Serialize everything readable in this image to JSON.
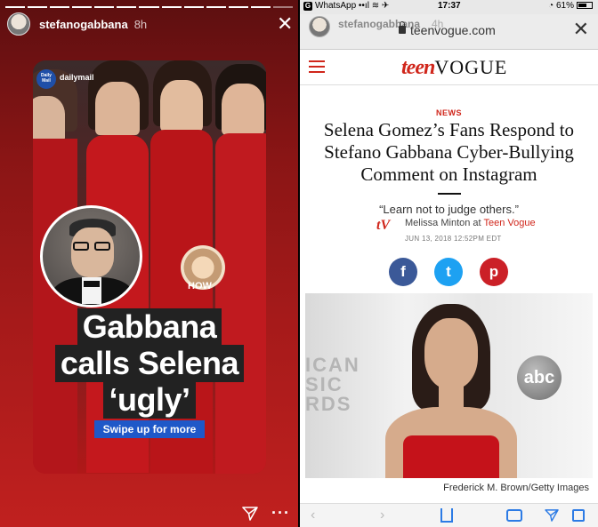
{
  "left_story": {
    "username": "stefanogabbana",
    "time": "8h",
    "close_glyph": "✕",
    "source_label": "dailymail",
    "source_logo": "Daily Mail",
    "inset_label": "HOW",
    "headline": [
      "Gabbana",
      "calls Selena",
      "‘ugly’"
    ],
    "cta": "Swipe up for more",
    "more_glyph": "···"
  },
  "right_story": {
    "status": {
      "app": "WhatsApp",
      "time": "17:37",
      "battery": "61%"
    },
    "username": "stefanogabbana",
    "time": "4h",
    "url": "teenvogue.com",
    "close_glyph": "✕",
    "logo": {
      "teen": "teen",
      "vogue": "VOGUE"
    },
    "section": "NEWS",
    "title": "Selena Gomez’s Fans Respond to Stefano Gabbana Cyber-Bullying Comment on Instagram",
    "dek": "“Learn not to judge others.”",
    "author": "Melissa Minton",
    "author_at": "at",
    "publication": "Teen Vogue",
    "date": "JUN 13, 2018 12:52PM EDT",
    "share": {
      "facebook": "f",
      "twitter": "t",
      "pinterest": "p"
    },
    "photo_wall_text": [
      "ICAN",
      "SIC",
      "RDS"
    ],
    "photo_logo": "abc",
    "photo_credit": "Frederick M. Brown/Getty Images"
  },
  "colors": {
    "facebook": "#3b5998",
    "twitter": "#1da1f2",
    "pinterest": "#cb2027",
    "teen_vogue_red": "#d0261b",
    "swipe_blue": "#1f58c8"
  }
}
